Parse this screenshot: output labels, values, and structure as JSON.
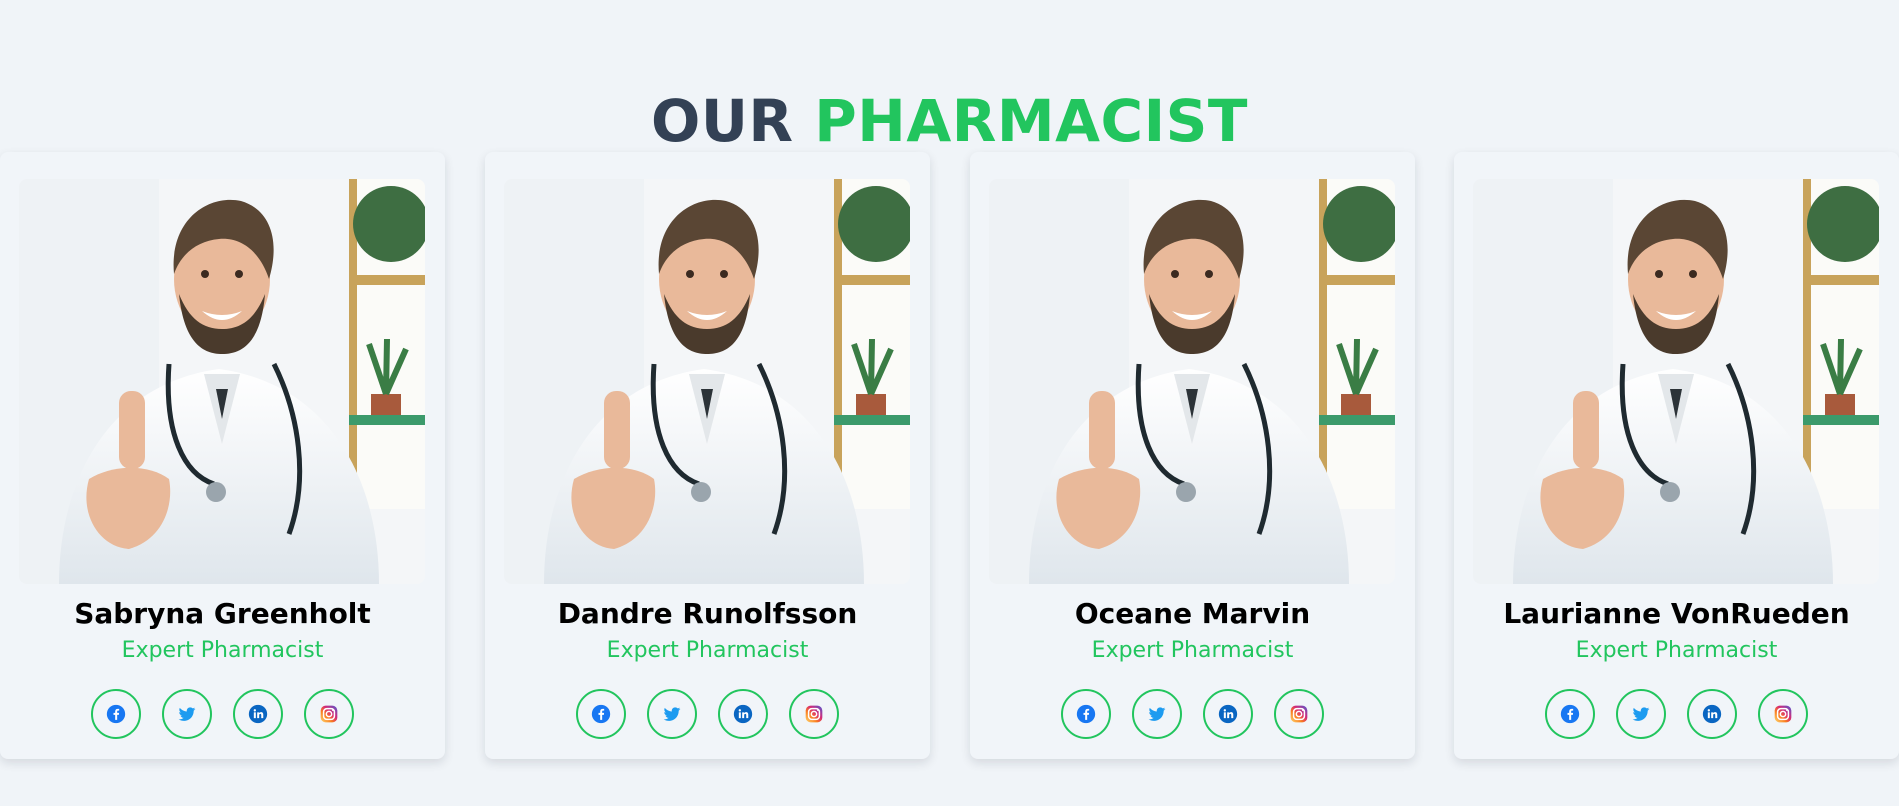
{
  "heading": {
    "part1": "OUR",
    "part2": "PHARMACIST"
  },
  "colors": {
    "accent": "#22c55e",
    "heading_dark": "#334155",
    "background": "#f0f4f8",
    "icon_blue": "#1877f2"
  },
  "pharmacists": [
    {
      "name": "Sabryna Greenholt",
      "role": "Expert Pharmacist"
    },
    {
      "name": "Dandre Runolfsson",
      "role": "Expert Pharmacist"
    },
    {
      "name": "Oceane Marvin",
      "role": "Expert Pharmacist"
    },
    {
      "name": "Laurianne VonRueden",
      "role": "Expert Pharmacist"
    }
  ],
  "social_icons": [
    "facebook-icon",
    "twitter-icon",
    "linkedin-icon",
    "instagram-icon"
  ]
}
